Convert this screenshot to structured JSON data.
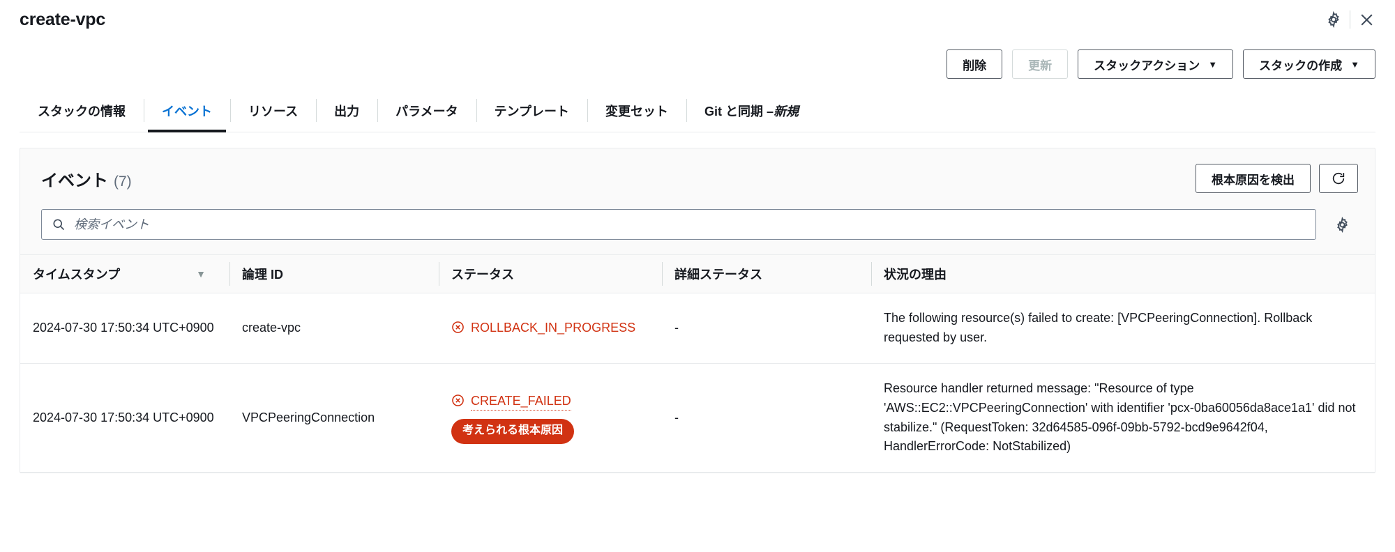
{
  "window": {
    "title": "create-vpc",
    "settings_icon": "gear-icon",
    "close_icon": "close-icon"
  },
  "toolbar": {
    "delete_label": "削除",
    "update_label": "更新",
    "stack_actions_label": "スタックアクション",
    "create_stack_label": "スタックの作成",
    "caret": "▼"
  },
  "tabs": [
    {
      "label": "スタックの情報",
      "active": false
    },
    {
      "label": "イベント",
      "active": true
    },
    {
      "label": "リソース",
      "active": false
    },
    {
      "label": "出力",
      "active": false
    },
    {
      "label": "パラメータ",
      "active": false
    },
    {
      "label": "テンプレート",
      "active": false
    },
    {
      "label": "変更セット",
      "active": false
    },
    {
      "label": "Git と同期 – ",
      "italic_suffix": "新規",
      "active": false
    }
  ],
  "events_panel": {
    "title": "イベント",
    "count": "(7)",
    "detect_root_cause_label": "根本原因を検出",
    "refresh_icon": "refresh-icon",
    "preferences_icon": "gear-icon",
    "search": {
      "placeholder": "検索イベント",
      "value": "",
      "icon": "search-icon"
    },
    "columns": [
      {
        "label": "タイムスタンプ",
        "sortable": true,
        "sort_caret": "▼"
      },
      {
        "label": "論理 ID",
        "sortable": false
      },
      {
        "label": "ステータス",
        "sortable": false
      },
      {
        "label": "詳細ステータス",
        "sortable": false
      },
      {
        "label": "状況の理由",
        "sortable": false
      }
    ],
    "rows": [
      {
        "timestamp": "2024-07-30 17:50:34 UTC+0900",
        "logical_id": "create-vpc",
        "status": "ROLLBACK_IN_PROGRESS",
        "status_color": "#d13212",
        "status_icon": "error-circle-x-icon",
        "has_root_cause_badge": false,
        "root_cause_badge": "",
        "detailed_status": "-",
        "status_reason": "The following resource(s) failed to create: [VPCPeeringConnection]. Rollback requested by user."
      },
      {
        "timestamp": "2024-07-30 17:50:34 UTC+0900",
        "logical_id": "VPCPeeringConnection",
        "status": "CREATE_FAILED",
        "status_color": "#d13212",
        "status_icon": "error-circle-x-icon",
        "has_root_cause_badge": true,
        "root_cause_badge": "考えられる根本原因",
        "detailed_status": "-",
        "status_reason": "Resource handler returned message: \"Resource of type 'AWS::EC2::VPCPeeringConnection' with identifier 'pcx-0ba60056da8ace1a1' did not stabilize.\" (RequestToken: 32d64585-096f-09bb-5792-bcd9e9642f04, HandlerErrorCode: NotStabilized)"
      }
    ]
  },
  "colors": {
    "accent_blue": "#0972d3",
    "error_red": "#d13212",
    "text": "#16191f",
    "border": "#e9ebed"
  }
}
